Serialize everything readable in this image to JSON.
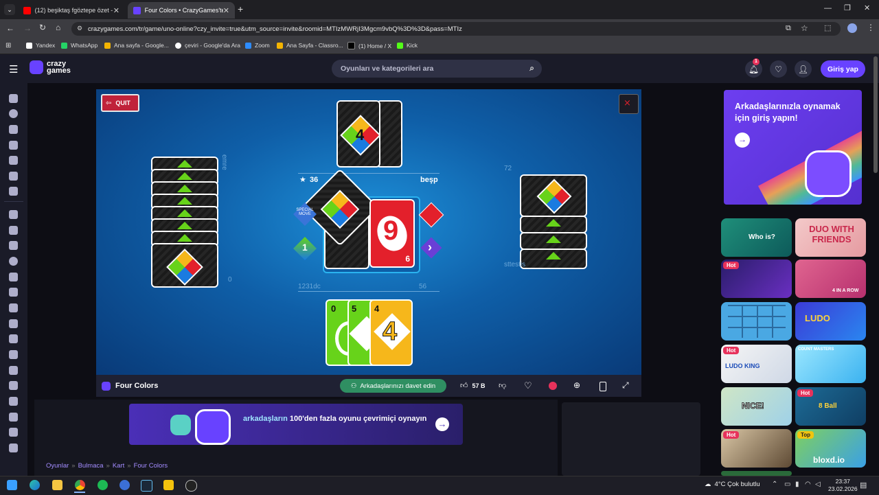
{
  "browser": {
    "tabs": [
      {
        "label": "(12) beşiktaş fgöztepe özet - Yo"
      },
      {
        "label": "Four Colors • CrazyGames'te"
      }
    ],
    "url": "crazygames.com/tr/game/uno-online?czy_invite=true&utm_source=invite&roomid=MTIzMWRjI3Mgcm9vbQ%3D%3D&pass=MTIz",
    "bookmarks": [
      "Yandex",
      "WhatsApp",
      "Ana sayfa - Google...",
      "çeviri - Google'da Ara",
      "Zoom",
      "Ana Sayfa - Classro...",
      "(1) Home / X",
      "Kick"
    ]
  },
  "site": {
    "logo_line1": "crazy",
    "logo_line2": "games",
    "search_placeholder": "Oyunları ve kategorileri ara",
    "notification_count": "1",
    "login_label": "Giriş yap"
  },
  "game": {
    "quit_label": "QUIT",
    "score_left": "36",
    "opponent_top_name": "beşp",
    "left_player_name": "emre",
    "right_player_name": "sttestis",
    "bottom_left_name": "1231dc",
    "bottom_right_score": "56",
    "right_score": "72",
    "left_score": "0",
    "center_card_value": "9",
    "center_card_small": "6",
    "special_label": "SPECIAL MOVE",
    "skip_label": "1",
    "hand_cards": [
      "0",
      "5",
      "4"
    ],
    "title": "Four Colors",
    "invite_label": "Arkadaşlarınızı davet edin",
    "likes": "57 B"
  },
  "ads": {
    "promo_text": "Arkadaşlarınızla oynamak için giriş yapın!",
    "banner_text_bold": "arkadaşların",
    "banner_text_rest": " 100'den fazla oyunu çevrimiçi oynayın",
    "thumbnails": [
      {
        "title": "Who is?",
        "badge": ""
      },
      {
        "title": "DUO WITH FRIENDS",
        "badge": ""
      },
      {
        "title": "",
        "badge": "Hot"
      },
      {
        "title": "4 IN A ROW",
        "badge": ""
      },
      {
        "title": "",
        "badge": ""
      },
      {
        "title": "LUDO",
        "badge": ""
      },
      {
        "title": "LUDO KING",
        "badge": "Hot"
      },
      {
        "title": "COUNT MASTERS",
        "badge": ""
      },
      {
        "title": "NICE!",
        "badge": ""
      },
      {
        "title": "8 Ball",
        "badge": "Hot"
      },
      {
        "title": "",
        "badge": "Hot"
      },
      {
        "title": "bloxd.io",
        "badge": "Top"
      },
      {
        "title": "",
        "badge": "Hot"
      }
    ]
  },
  "breadcrumb": [
    "Oyunlar",
    "Bulmaca",
    "Kart",
    "Four Colors"
  ],
  "taskbar": {
    "weather": "4°C  Çok bulutlu",
    "time": "23:37",
    "date": "23.02.2026"
  },
  "colors": {
    "accent": "#6842ff",
    "uno_red": "#e3202b",
    "uno_green": "#67d31a",
    "uno_yellow": "#f6b71b",
    "uno_blue": "#1a7be0"
  }
}
